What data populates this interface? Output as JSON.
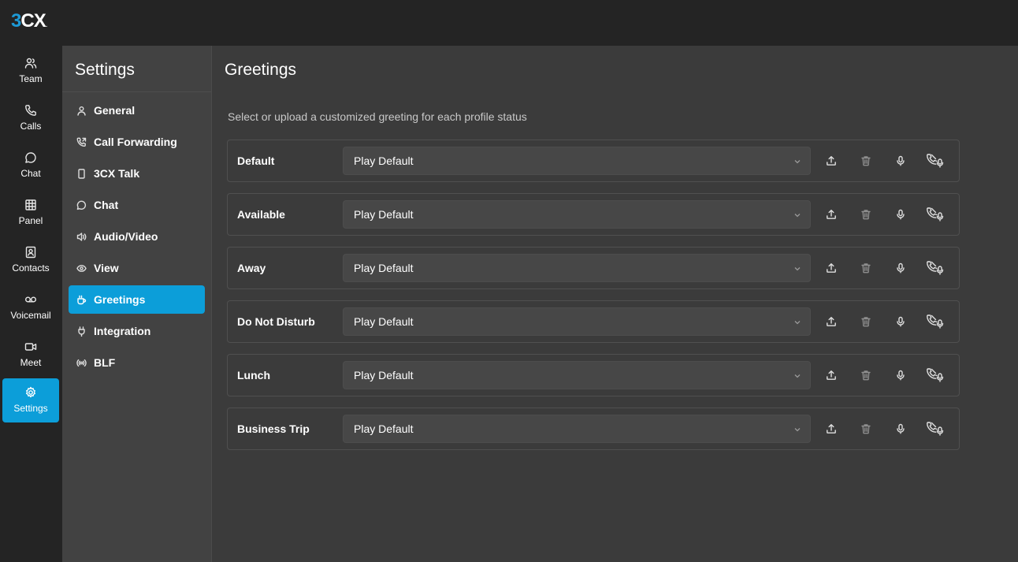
{
  "logo": {
    "number": "3",
    "text": "CX",
    "dot": "."
  },
  "rail": [
    {
      "label": "Team",
      "icon": "team-icon"
    },
    {
      "label": "Calls",
      "icon": "phone-icon"
    },
    {
      "label": "Chat",
      "icon": "chat-icon"
    },
    {
      "label": "Panel",
      "icon": "grid-icon"
    },
    {
      "label": "Contacts",
      "icon": "contacts-icon"
    },
    {
      "label": "Voicemail",
      "icon": "voicemail-icon"
    },
    {
      "label": "Meet",
      "icon": "video-icon"
    },
    {
      "label": "Settings",
      "icon": "gear-icon",
      "active": true
    }
  ],
  "sidebar": {
    "title": "Settings",
    "items": [
      {
        "label": "General",
        "icon": "user-icon"
      },
      {
        "label": "Call Forwarding",
        "icon": "call-forward-icon"
      },
      {
        "label": "3CX Talk",
        "icon": "mobile-icon"
      },
      {
        "label": "Chat",
        "icon": "chat-icon"
      },
      {
        "label": "Audio/Video",
        "icon": "speaker-icon"
      },
      {
        "label": "View",
        "icon": "eye-icon"
      },
      {
        "label": "Greetings",
        "icon": "cup-icon",
        "active": true
      },
      {
        "label": "Integration",
        "icon": "plug-icon"
      },
      {
        "label": "BLF",
        "icon": "broadcast-icon"
      }
    ]
  },
  "main": {
    "title": "Greetings",
    "subtitle": "Select or upload a customized greeting for each profile status",
    "rows": [
      {
        "status": "Default",
        "greeting": "Play Default"
      },
      {
        "status": "Available",
        "greeting": "Play Default"
      },
      {
        "status": "Away",
        "greeting": "Play Default"
      },
      {
        "status": "Do Not Disturb",
        "greeting": "Play Default"
      },
      {
        "status": "Lunch",
        "greeting": "Play Default"
      },
      {
        "status": "Business Trip",
        "greeting": "Play Default"
      }
    ]
  },
  "colors": {
    "accent": "#0c9ed9",
    "logo_number": "#1d9ad6",
    "rail_bg": "#242424",
    "sidebar_bg": "#424242",
    "main_bg": "#3b3b3b"
  }
}
